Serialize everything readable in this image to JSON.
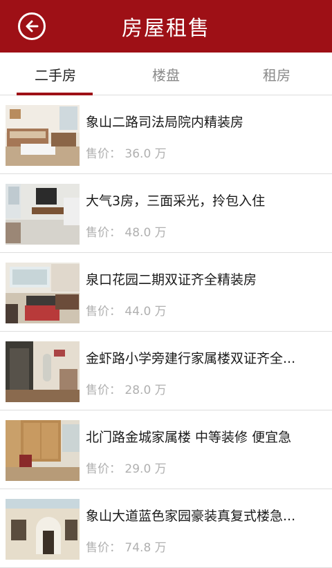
{
  "header": {
    "title": "房屋租售",
    "back_icon": "back-arrow-icon",
    "background_color": "#9e1016"
  },
  "tabs": [
    {
      "label": "二手房",
      "active": true
    },
    {
      "label": "楼盘",
      "active": false
    },
    {
      "label": "租房",
      "active": false
    }
  ],
  "accent_color": "#9e1016",
  "listings": [
    {
      "title": "象山二路司法局院内精装房",
      "price": "售价： 36.0 万"
    },
    {
      "title": "大气3房，三面采光，拎包入住",
      "price": "售价： 48.0 万"
    },
    {
      "title": "泉口花园二期双证齐全精装房",
      "price": "售价： 44.0 万"
    },
    {
      "title": "金虾路小学旁建行家属楼双证齐全...",
      "price": "售价： 28.0 万"
    },
    {
      "title": "北门路金城家属楼 中等装修 便宜急",
      "price": "售价： 29.0 万"
    },
    {
      "title": "象山大道蓝色家园豪装真复式楼急...",
      "price": "售价： 74.8 万"
    }
  ]
}
